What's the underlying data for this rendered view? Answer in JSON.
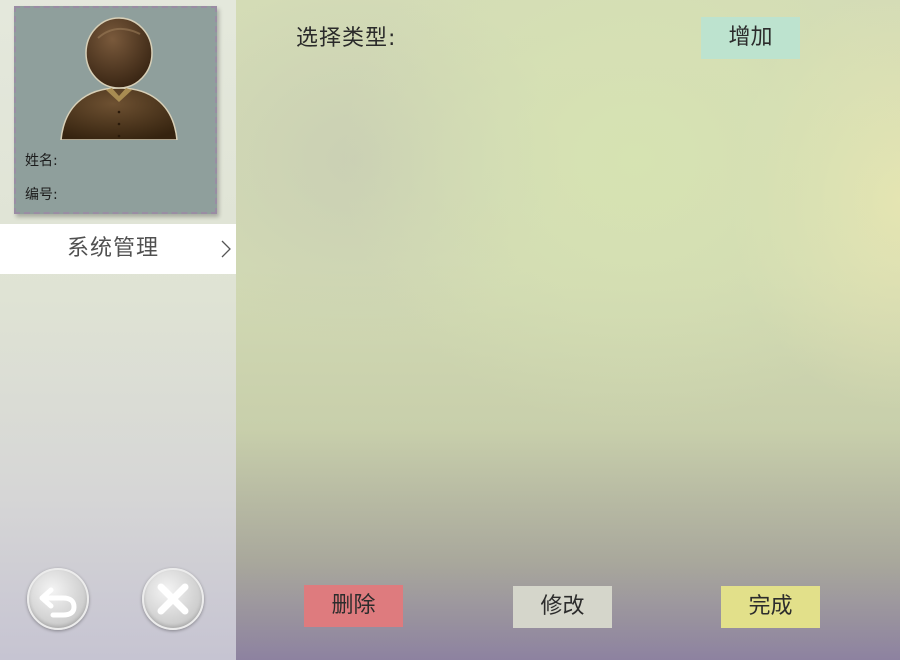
{
  "profile": {
    "name_label": "姓名:",
    "id_label": "编号:"
  },
  "menu": {
    "items": [
      {
        "label": "系统管理"
      }
    ]
  },
  "main": {
    "type_label": "选择类型:",
    "add_label": "增加",
    "delete_label": "删除",
    "modify_label": "修改",
    "done_label": "完成"
  },
  "icons": {
    "avatar": "user-silhouette-icon",
    "chevron": "chevron-right-icon",
    "back": "undo-arrow-icon",
    "close": "close-x-icon"
  },
  "colors": {
    "add": "#bde3cf",
    "delete": "#de7b7e",
    "modify": "#d5d6cb",
    "done": "#e2e08a"
  }
}
